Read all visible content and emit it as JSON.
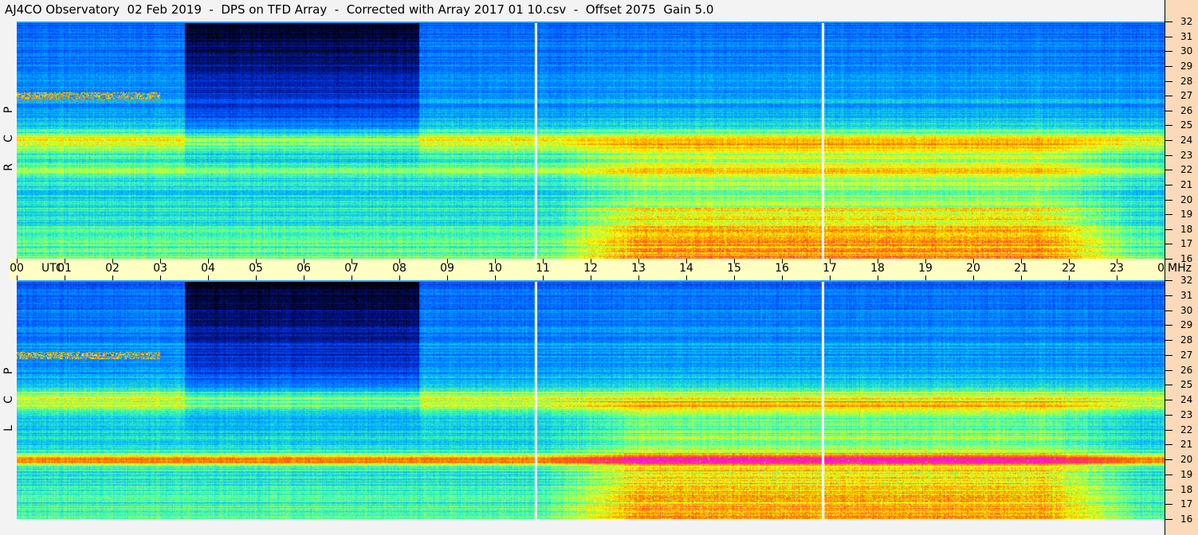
{
  "title": "AJ4CO Observatory  02 Feb 2019  -  DPS on TFD Array  -  Corrected with Array 2017 01 10.csv  -  Offset 2075  Gain 5.0",
  "chart_data": {
    "type": "heatmap",
    "title": "AJ4CO Observatory  02 Feb 2019  -  DPS on TFD Array  -  Corrected with Array 2017 01 10.csv  -  Offset 2075  Gain 5.0",
    "xlabel": "UTC",
    "ylabel": "MHz",
    "x_ticks": [
      "00",
      "01",
      "02",
      "03",
      "04",
      "05",
      "06",
      "07",
      "08",
      "09",
      "10",
      "11",
      "12",
      "13",
      "14",
      "15",
      "16",
      "17",
      "18",
      "19",
      "20",
      "21",
      "22",
      "23",
      "00"
    ],
    "xlim_hours": [
      0,
      24
    ],
    "y_ticks": [
      "32",
      "31",
      "30",
      "29",
      "28",
      "27",
      "26",
      "25",
      "24",
      "23",
      "22",
      "21",
      "20",
      "19",
      "18",
      "17",
      "16"
    ],
    "ylim_mhz": [
      16,
      32
    ],
    "calibration_gaps_utc_hours": [
      10.83,
      16.83
    ],
    "panels": [
      {
        "name": "RCP",
        "letters": [
          "R",
          "C",
          "P"
        ]
      },
      {
        "name": "LCP",
        "letters": [
          "L",
          "C",
          "P"
        ]
      }
    ],
    "colormap": [
      "#000010",
      "#0018a0",
      "#0050ff",
      "#00b0ff",
      "#40ffb0",
      "#ffff00",
      "#ff6000",
      "#ff00ff",
      "#ffffff"
    ]
  }
}
